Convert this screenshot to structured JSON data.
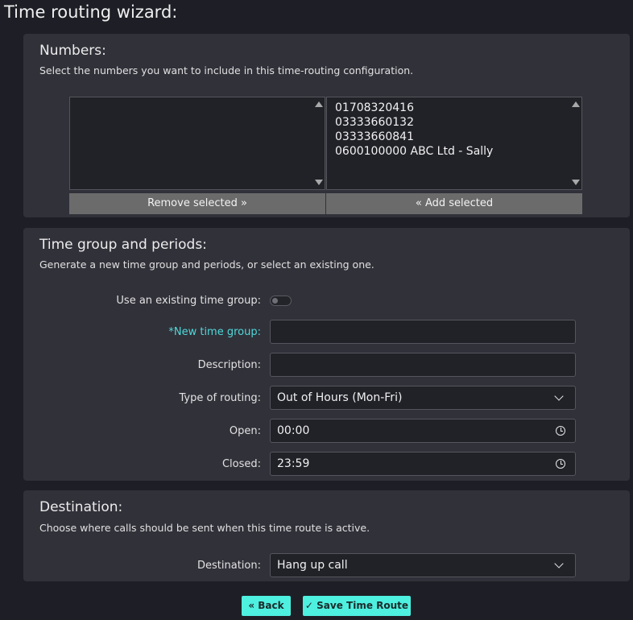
{
  "page": {
    "title": "Time routing wizard:"
  },
  "numbers": {
    "title": "Numbers:",
    "description": "Select the numbers you want to include in this time-routing configuration.",
    "selected_items": [],
    "available_items": [
      "01708320416",
      "03333660132",
      "03333660841",
      "0600100000 ABC Ltd - Sally"
    ],
    "remove_label": "Remove selected »",
    "add_label": "« Add selected"
  },
  "time_group": {
    "title": "Time group and periods:",
    "description": "Generate a new time group and periods, or select an existing one.",
    "use_existing_label": "Use an existing time group:",
    "use_existing_value": false,
    "new_group_label": "*New time group:",
    "new_group_value": "",
    "description_label": "Description:",
    "description_value": "",
    "routing_type_label": "Type of routing:",
    "routing_type_value": "Out of Hours (Mon-Fri)",
    "open_label": "Open:",
    "open_value": "00:00",
    "closed_label": "Closed:",
    "closed_value": "23:59"
  },
  "destination": {
    "title": "Destination:",
    "description": "Choose where calls should be sent when this time route is active.",
    "label": "Destination:",
    "value": "Hang up call"
  },
  "actions": {
    "back_label": "« Back",
    "save_label": "✓ Save Time Route"
  },
  "colors": {
    "background": "#1e1f26",
    "panel": "#31313a",
    "accent": "#4ef0e0",
    "required_label": "#4fd8d8"
  }
}
